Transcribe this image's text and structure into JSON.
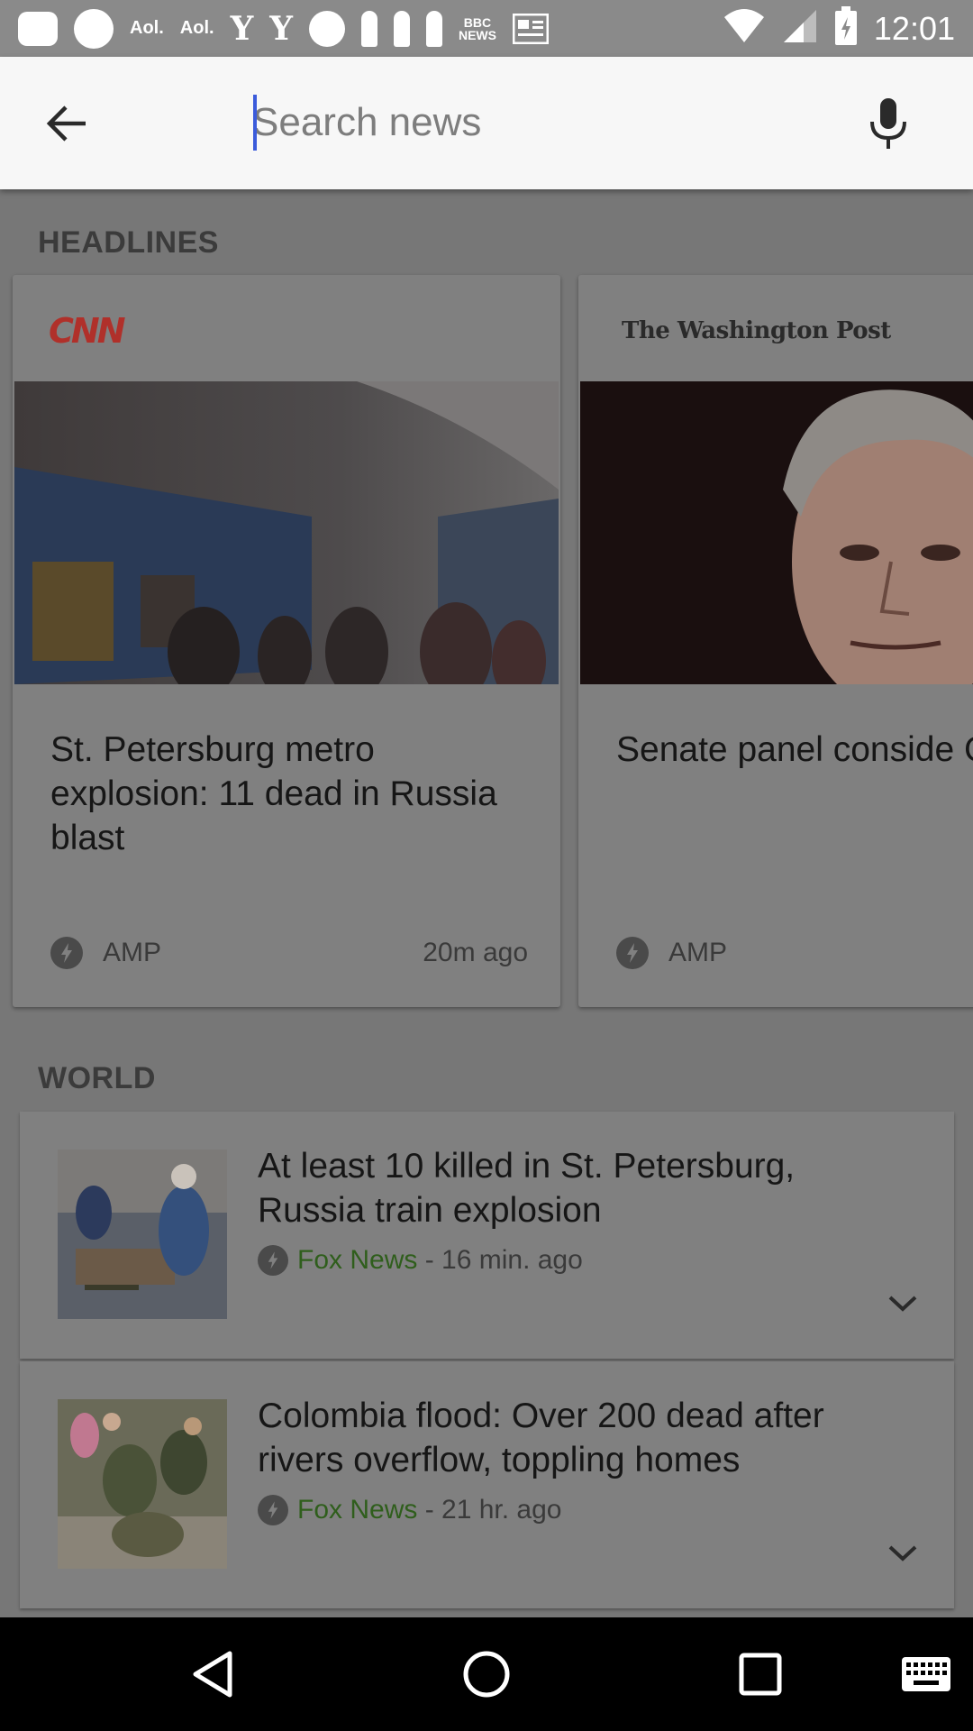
{
  "status_bar": {
    "time": "12:01",
    "notification_icons": [
      "message-icon",
      "aol-app-icon",
      "aol-icon",
      "aol-icon",
      "yahoo-icon",
      "yahoo-icon",
      "yahoo-mail-icon",
      "key-icon",
      "key-icon",
      "key-icon",
      "bbc-news-icon",
      "newspaper-icon"
    ],
    "aol_text": "Aol.",
    "yahoo_text": "Y",
    "bbc_text": "BBC",
    "news_text": "NEWS"
  },
  "search": {
    "placeholder": "Search news",
    "value": ""
  },
  "headlines": {
    "section_label": "HEADLINES",
    "cards": [
      {
        "source": "CNN",
        "headline": "St. Petersburg metro explosion: 11 dead in Russia blast",
        "badge": "AMP",
        "time": "20m ago"
      },
      {
        "source": "The Washington Post",
        "headline": "Senate panel conside Gorsuch as threat of filibuster looms",
        "badge": "AMP",
        "time": ""
      }
    ]
  },
  "world": {
    "section_label": "WORLD",
    "items": [
      {
        "title": "At least 10 killed in St. Petersburg, Russia train explosion",
        "source": "Fox News",
        "separator": " - ",
        "time": "16 min. ago"
      },
      {
        "title": "Colombia flood: Over 200 dead after rivers overflow, toppling homes",
        "source": "Fox News",
        "separator": " - ",
        "time": "21 hr. ago"
      }
    ]
  },
  "colors": {
    "scrim": "#777777",
    "search_bg": "#f7f7f7",
    "cursor": "#3b5bdb",
    "source_green": "#2f5e1c",
    "cnn_red": "#b0302a"
  }
}
